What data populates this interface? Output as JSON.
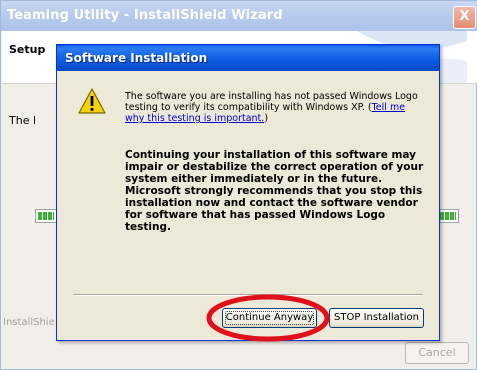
{
  "outer_window": {
    "title": "Teaming Utility - InstallShield Wizard",
    "close_glyph": "X",
    "setup_label": "Setup",
    "body_text_fragment": "The l",
    "brand_fragment": "InstallShie",
    "cancel_label": "Cancel"
  },
  "dialog": {
    "title": "Software Installation",
    "icon": "warning-icon",
    "message1_prefix": "The software you are installing has not passed Windows Logo testing to verify its compatibility with Windows XP. (",
    "message1_link": "Tell me why this testing is important.",
    "message1_suffix": ")",
    "message2": "Continuing your installation of this software may impair or destabilize the correct operation of your system either immediately or in the future. Microsoft strongly recommends that you stop this installation now and contact the software vendor for software that has passed Windows Logo testing.",
    "continue_label": "Continue Anyway",
    "stop_label": "STOP Installation"
  },
  "annotation": {
    "ring_color": "#e0101a",
    "target": "Continue Anyway"
  }
}
